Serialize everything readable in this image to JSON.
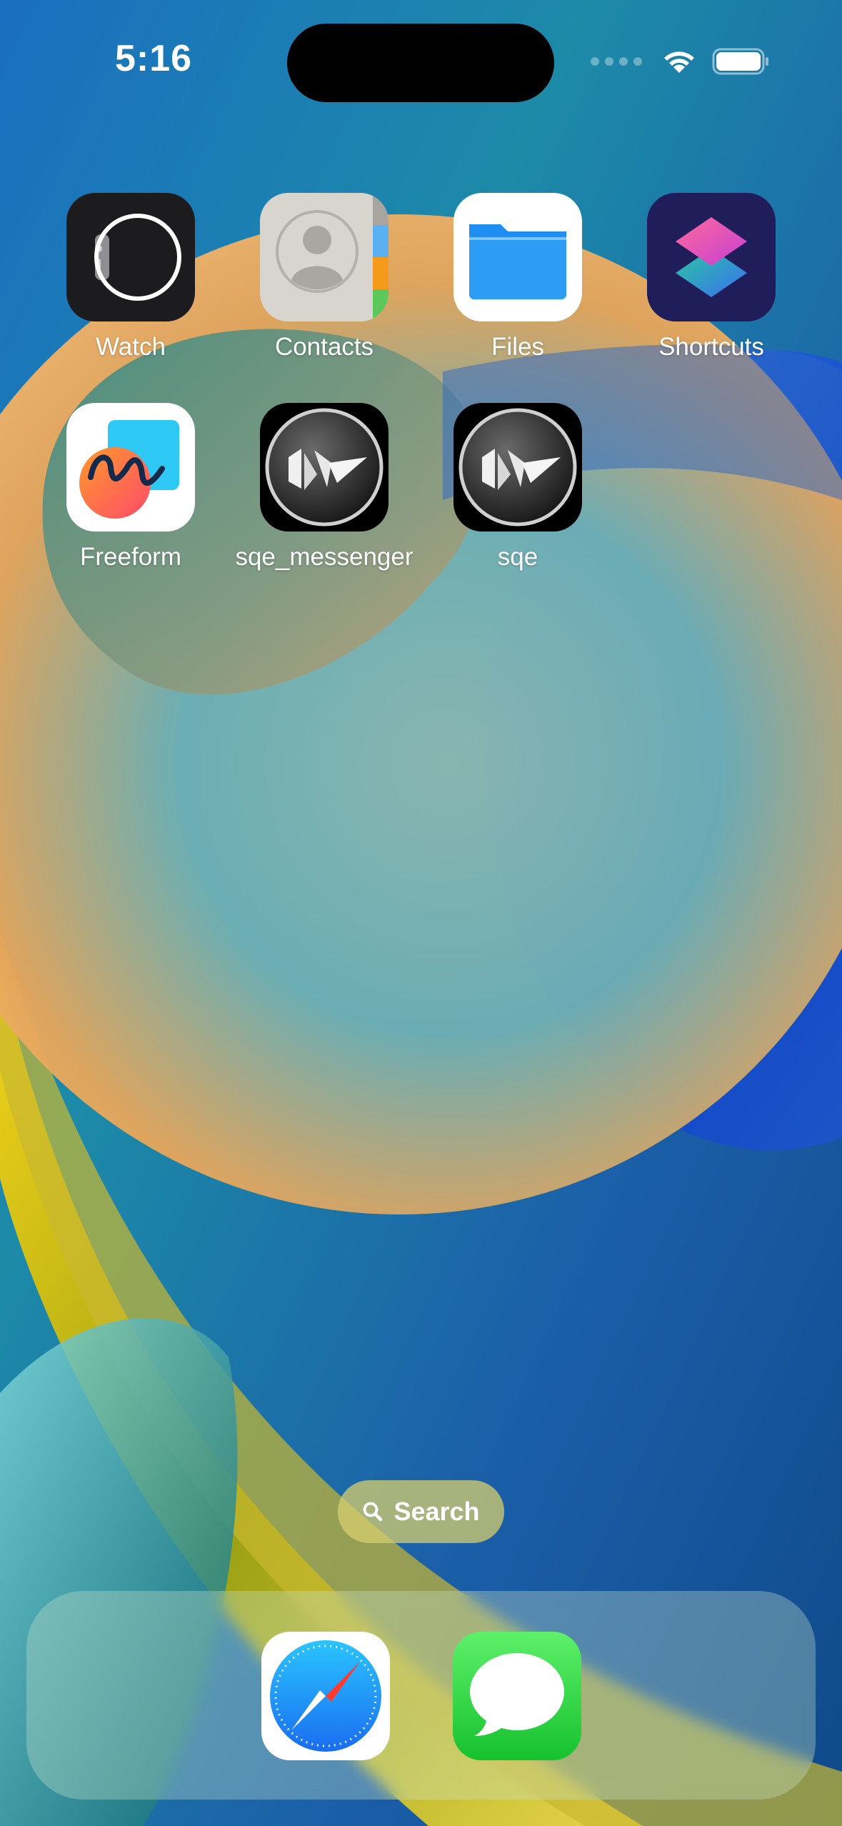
{
  "status_bar": {
    "time": "5:16"
  },
  "apps": [
    {
      "label": "Watch",
      "icon": "watch-app-icon"
    },
    {
      "label": "Contacts",
      "icon": "contacts-app-icon"
    },
    {
      "label": "Files",
      "icon": "files-app-icon"
    },
    {
      "label": "Shortcuts",
      "icon": "shortcuts-app-icon"
    },
    {
      "label": "Freeform",
      "icon": "freeform-app-icon"
    },
    {
      "label": "sqe_messenger",
      "icon": "kivy-app-icon"
    },
    {
      "label": "sqe",
      "icon": "kivy-app-icon"
    }
  ],
  "search": {
    "label": "Search"
  },
  "dock": [
    {
      "name": "Safari",
      "icon": "safari-app-icon"
    },
    {
      "name": "Messages",
      "icon": "messages-app-icon"
    }
  ]
}
